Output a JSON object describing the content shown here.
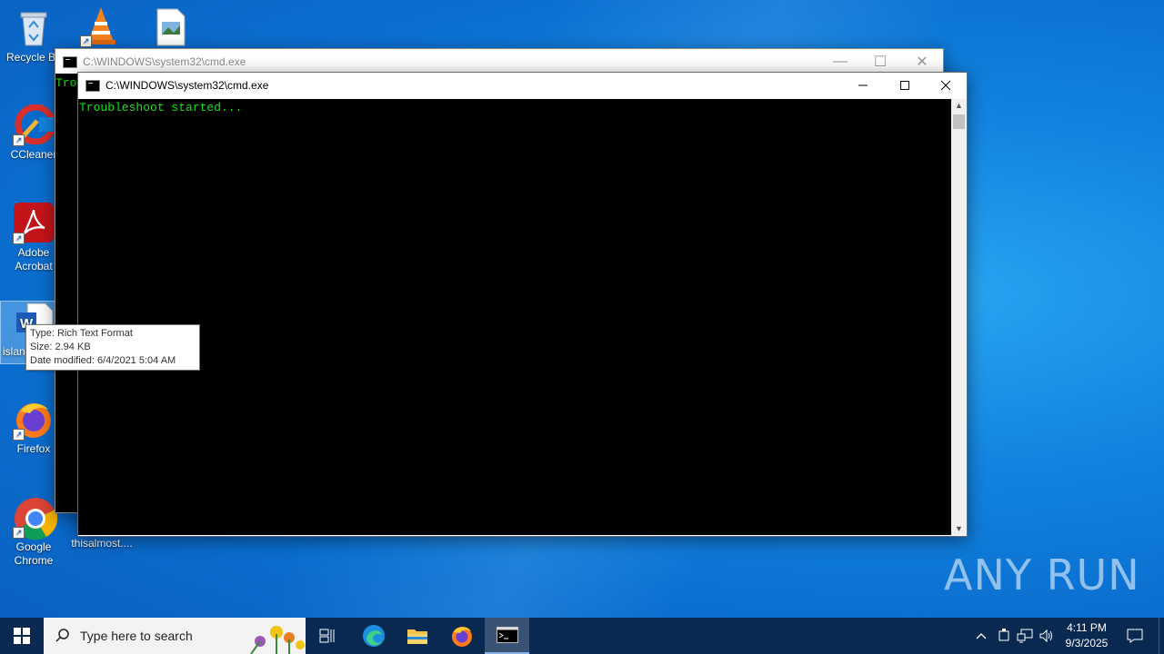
{
  "desktop": {
    "icons": [
      {
        "label": "Recycle Bin",
        "icon": "recycle-bin-icon"
      },
      {
        "label": "",
        "icon": "vlc-icon"
      },
      {
        "label": "",
        "icon": "image-file-icon"
      },
      {
        "label": "CCleaner",
        "icon": "ccleaner-icon"
      },
      {
        "label": "Adobe Acrobat",
        "icon": "acrobat-icon"
      },
      {
        "label": "islan",
        "icon": "word-document-icon"
      },
      {
        "label": "Firefox",
        "icon": "firefox-icon"
      },
      {
        "label": "Google Chrome",
        "icon": "chrome-icon"
      },
      {
        "label": "thisalmost....",
        "icon": "file-icon"
      }
    ]
  },
  "back_window": {
    "title": "C:\\WINDOWS\\system32\\cmd.exe",
    "console_text": "Tro"
  },
  "front_window": {
    "title": "C:\\WINDOWS\\system32\\cmd.exe",
    "console_text": "Troubleshoot started...",
    "console_color": "#13e313"
  },
  "tooltip": {
    "type": "Type: Rich Text Format",
    "size": "Size: 2.94 KB",
    "date": "Date modified: 6/4/2021 5:04 AM"
  },
  "taskbar": {
    "search_placeholder": "Type here to search",
    "apps": [
      "task-view-icon",
      "edge-icon",
      "file-explorer-icon",
      "firefox-icon",
      "cmd-icon"
    ],
    "time": "4:11 PM",
    "date": "9/3/2025"
  },
  "watermark": "ANY RUN",
  "colors": {
    "taskbar": "#0a2950",
    "desktop": "#0a6fd0"
  }
}
